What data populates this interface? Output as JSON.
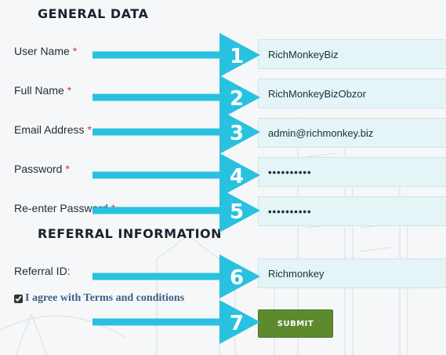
{
  "general_section": {
    "title": "General Data"
  },
  "fields": [
    {
      "label": "User Name",
      "required": true,
      "value": "RichMonkeyBiz"
    },
    {
      "label": "Full Name",
      "required": true,
      "value": "RichMonkeyBizObzor"
    },
    {
      "label": "Email Address",
      "required": true,
      "value": "admin@richmonkey.biz"
    },
    {
      "label": "Password",
      "required": true,
      "value": "••••••••••"
    },
    {
      "label": "Re-enter Password",
      "required": true,
      "value": "••••••••••"
    }
  ],
  "required_marker": "*",
  "referral_section": {
    "title": "Referral Information"
  },
  "referral": {
    "label": "Referral ID:",
    "value": "Richmonkey"
  },
  "agree": {
    "text": "I agree with Terms and conditions",
    "checked": true
  },
  "submit": {
    "label": "Submit"
  },
  "arrows": {
    "numbers": [
      "1",
      "2",
      "3",
      "4",
      "5",
      "6",
      "7"
    ],
    "color": "#29c1e0",
    "number_color": "#ffffff"
  }
}
